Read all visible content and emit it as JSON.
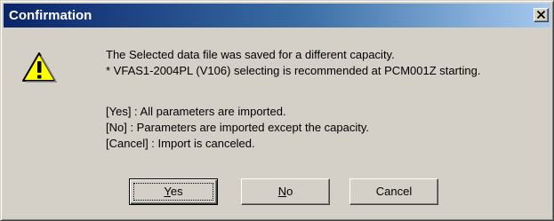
{
  "dialog": {
    "title": "Confirmation",
    "close_label": "×",
    "icon": "warning-icon",
    "message_lines": [
      "The Selected data file was saved for a different capacity.",
      "* VFAS1-2004PL (V106) selecting is recommended at PCM001Z starting."
    ],
    "option_lines": [
      "[Yes] : All parameters are imported.",
      "[No] : Parameters are imported except the capacity.",
      "[Cancel] : Import is canceled."
    ],
    "buttons": {
      "yes": {
        "mnemonic": "Y",
        "rest": "es"
      },
      "no": {
        "mnemonic": "N",
        "rest": "o"
      },
      "cancel": {
        "label": "Cancel"
      }
    }
  },
  "colors": {
    "title_bar_start": "#0a246a",
    "title_bar_end": "#a6caf0",
    "dialog_face": "#d4d0c8",
    "warning_fill": "#ffff00"
  }
}
